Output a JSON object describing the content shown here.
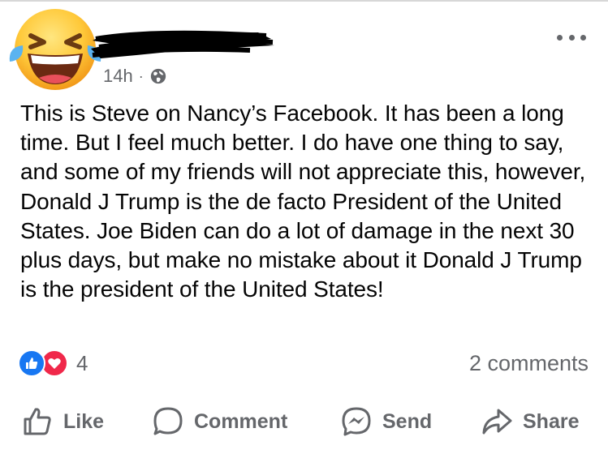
{
  "post": {
    "timestamp": "14h",
    "separator": "·",
    "audience_icon": "globe-icon",
    "more_icon": "more-options-icon",
    "text": "This is Steve on Nancy’s Facebook. It has been a long time. But I feel much better. I do have one thing to say, and some of my friends will not appreciate this, however, Donald J Trump is the de facto President of the United States. Joe Biden can do a lot of damage in the next 30 plus days, but make no mistake about it Donald J Trump is the president of the United States!"
  },
  "reactions": {
    "types": [
      "like",
      "love"
    ],
    "count": "4"
  },
  "comments": {
    "label": "2 comments"
  },
  "actions": {
    "like": "Like",
    "comment": "Comment",
    "send": "Send",
    "share": "Share"
  },
  "colors": {
    "like_blue": "#1877f2",
    "love_red": "#f0284a",
    "secondary_text": "#65676b",
    "emoji_yellow": "#ffc93a"
  }
}
